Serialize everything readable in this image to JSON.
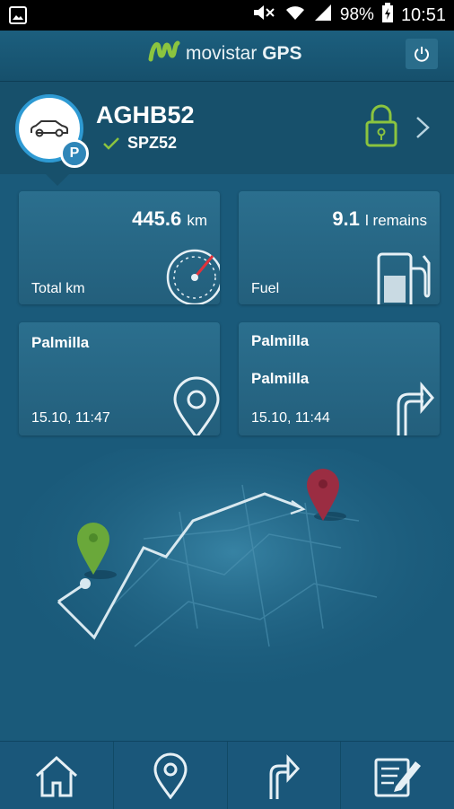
{
  "status": {
    "battery": "98%",
    "time": "10:51",
    "icons": [
      "image-icon",
      "mute-icon",
      "wifi-icon",
      "signal-icon",
      "battery-icon"
    ]
  },
  "app": {
    "brand_prefix": "movistar",
    "brand_suffix": "GPS",
    "logo_color": "#8bc43f"
  },
  "vehicle": {
    "plate": "AGHB52",
    "sub_plate": "SPZ52",
    "parking_badge": "P",
    "lock_color": "#8bc43f",
    "accent": "#2e9ad3"
  },
  "cards": {
    "total_km": {
      "value": "445.6",
      "unit": "km",
      "label": "Total km"
    },
    "fuel": {
      "value": "9.1",
      "unit": "l remains",
      "label": "Fuel"
    },
    "position": {
      "place": "Palmilla",
      "timestamp": "15.10, 11:47"
    },
    "trip": {
      "from": "Palmilla",
      "to": "Palmilla",
      "timestamp": "15.10, 11:44"
    }
  },
  "nav": {
    "tabs": [
      "home",
      "location",
      "route",
      "notes"
    ],
    "icons": [
      "home-icon",
      "location-pin-icon",
      "route-arrow-icon",
      "notes-icon"
    ]
  }
}
